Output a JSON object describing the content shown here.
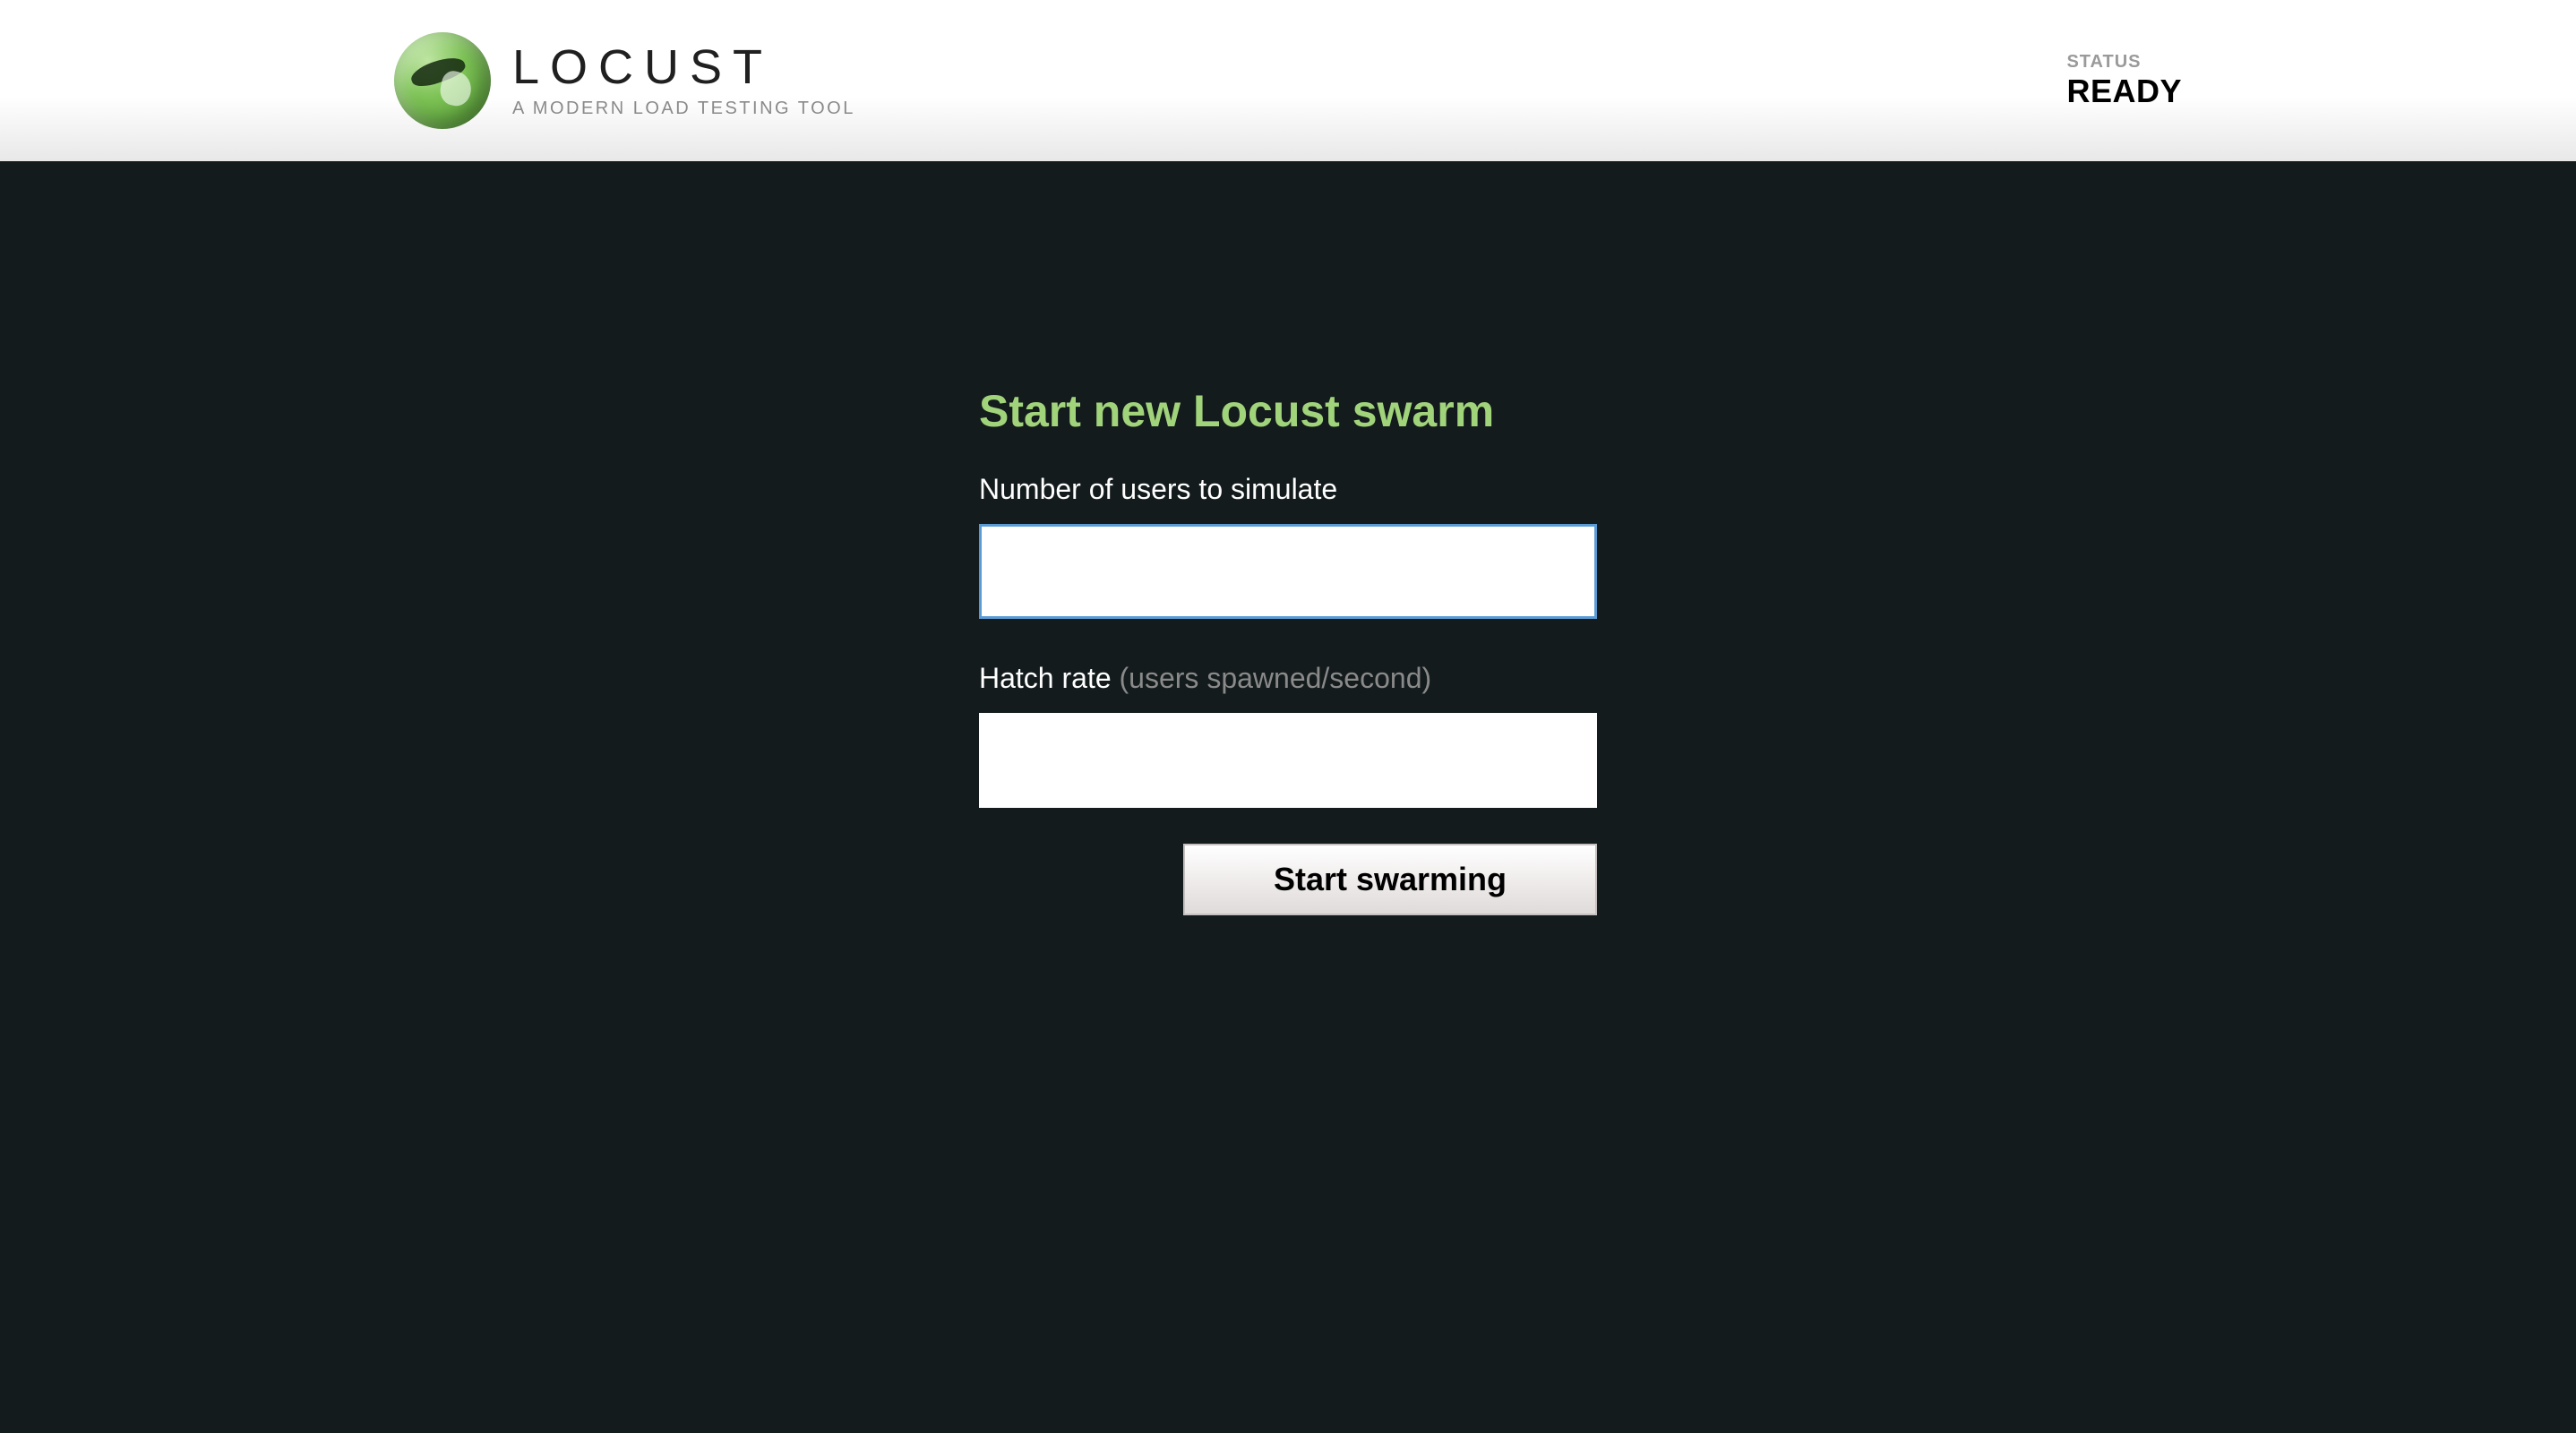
{
  "header": {
    "logo": {
      "title": "LOCUST",
      "subtitle": "A MODERN LOAD TESTING TOOL"
    },
    "status": {
      "label": "STATUS",
      "value": "READY"
    }
  },
  "form": {
    "title": "Start new Locust swarm",
    "users_label": "Number of users to simulate",
    "users_value": "",
    "hatch_label": "Hatch rate ",
    "hatch_hint": "(users spawned/second)",
    "hatch_value": "",
    "submit_label": "Start swarming"
  }
}
